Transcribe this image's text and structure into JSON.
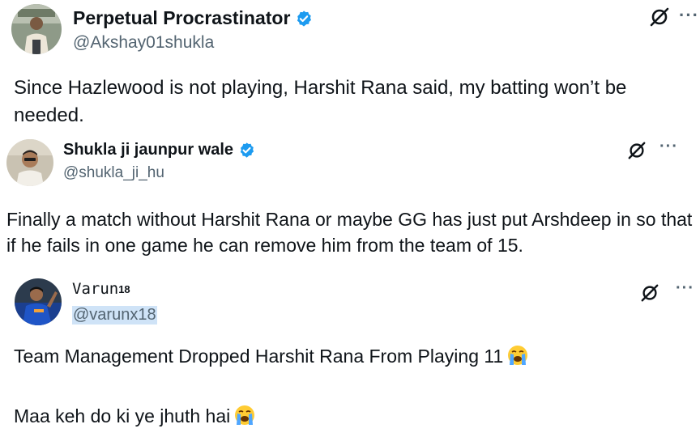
{
  "tweets": [
    {
      "name": "Perpetual Procrastinator",
      "handle": "@Akshay01shukla",
      "text": "Since Hazlewood is not playing, Harshit Rana said, my batting won’t be needed.",
      "verified": true
    },
    {
      "name": "Shukla ji jaunpur wale",
      "handle": "@shukla_ji_hu",
      "text": "Finally a match without Harshit Rana or maybe GG has just put Arshdeep in so that if he fails in one game he can remove him from the team of 15.",
      "verified": true
    },
    {
      "name": "Varun",
      "name_superscript": "18",
      "handle": "@varunx18",
      "text_lines": [
        "Team Management Dropped Harshit Rana From Playing 11",
        "Maa keh do ki ye jhuth hai"
      ],
      "emoji": "loudly-crying-face",
      "verified": false
    }
  ],
  "icons": {
    "verified": "verified-badge-icon",
    "grok": "grok-icon",
    "more": "more-options-icon"
  },
  "more_label": "···",
  "colors": {
    "verified": "#1d9bf0",
    "handle": "#536471",
    "text": "#0f1419",
    "highlight": "#cfe3f7"
  }
}
